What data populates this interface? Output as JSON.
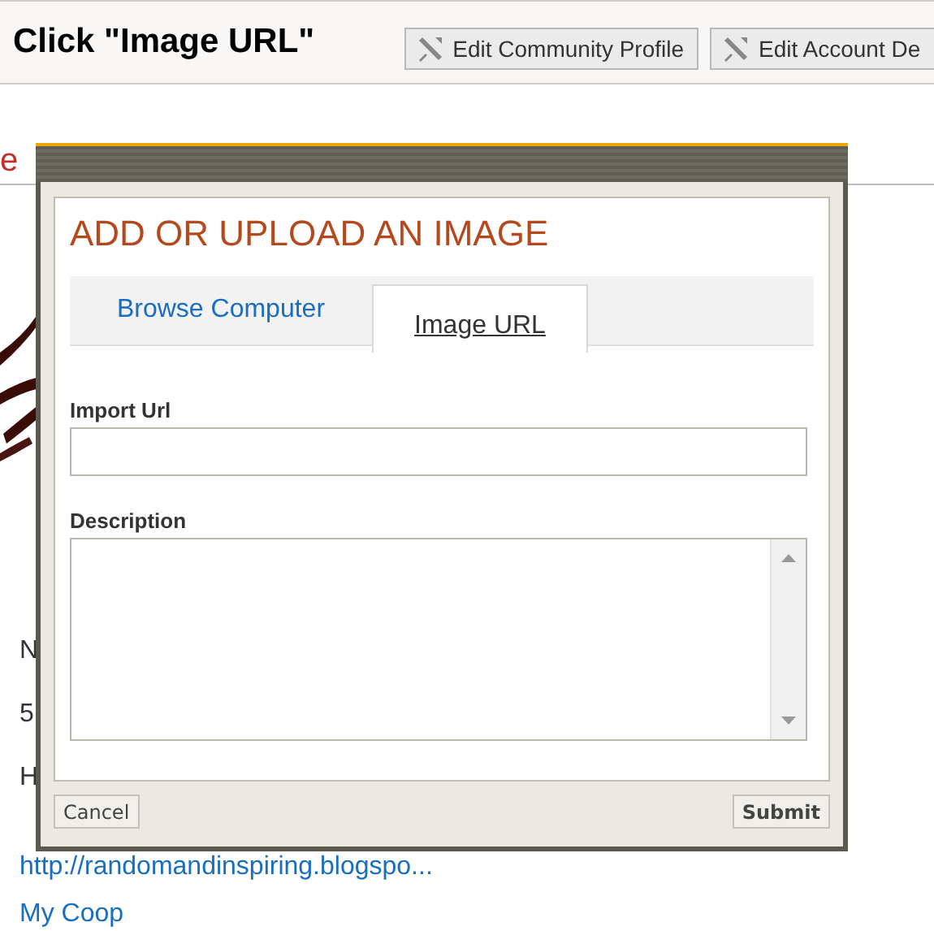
{
  "header": {
    "title": "Click \"Image URL\"",
    "buttons": [
      {
        "label": "Edit Community Profile"
      },
      {
        "label": "Edit Account De"
      }
    ]
  },
  "background": {
    "fragment": "e",
    "lines": [
      {
        "kind": "text",
        "text": "N"
      },
      {
        "kind": "text",
        "text": "5"
      },
      {
        "kind": "text",
        "text": "H"
      },
      {
        "kind": "link",
        "text": "http://randomandinspiring.blogspo..."
      },
      {
        "kind": "link",
        "text": "My Coop"
      }
    ]
  },
  "dialog": {
    "title": "ADD OR UPLOAD AN IMAGE",
    "tabs": [
      {
        "label": "Browse Computer",
        "selected": false
      },
      {
        "label": "Image URL",
        "selected": true
      }
    ],
    "fields": [
      {
        "kind": "input",
        "label": "Import Url"
      },
      {
        "kind": "textarea",
        "label": "Description"
      }
    ],
    "buttons": [
      {
        "label": "Cancel",
        "kind": "cancel"
      },
      {
        "label": "Submit",
        "kind": "submit"
      }
    ]
  }
}
